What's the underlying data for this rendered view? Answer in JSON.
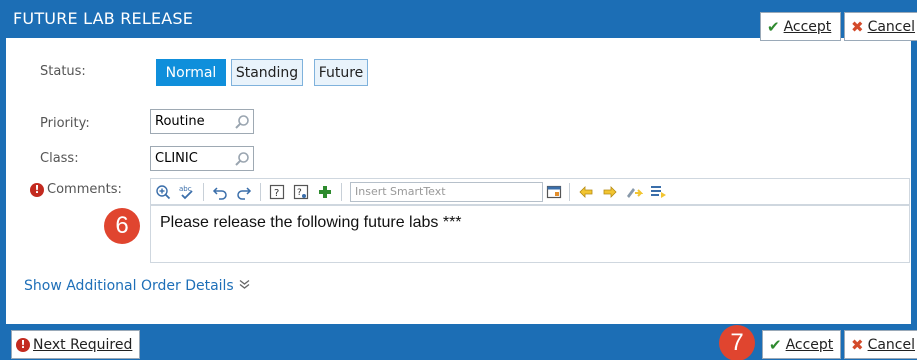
{
  "header": {
    "title": "FUTURE LAB RELEASE",
    "accept_label": "Accept",
    "cancel_label": "Cancel"
  },
  "form": {
    "status_label": "Status:",
    "status_options": [
      "Normal",
      "Standing",
      "Future"
    ],
    "status_selected": "Normal",
    "priority_label": "Priority:",
    "priority_value": "Routine",
    "class_label": "Class:",
    "class_value": "CLINIC",
    "comments_label": "Comments:",
    "smarttext_placeholder": "Insert SmartText",
    "comment_text": "Please release the following future labs ***",
    "show_more_label": "Show Additional Order Details"
  },
  "annotations": {
    "badge_comment": "6",
    "badge_accept": "7"
  },
  "footer": {
    "next_required_label": "Next Required",
    "accept_label": "Accept",
    "cancel_label": "Cancel"
  },
  "colors": {
    "header_blue": "#1c6eb5",
    "selected_blue": "#0f8fdb",
    "badge_red": "#e0452f",
    "accept_green": "#2f8a2f",
    "cancel_red": "#d34a2a"
  },
  "icons": [
    "search-icon",
    "zoom-in-icon",
    "spell-check-icon",
    "undo-icon",
    "redo-icon",
    "help-icon",
    "help-field-icon",
    "add-icon",
    "smarttext-list-icon",
    "arrow-left-icon",
    "arrow-right-icon",
    "link-icon",
    "list-icon",
    "checkmark-icon",
    "x-icon",
    "required-icon",
    "chevron-down-icon"
  ]
}
